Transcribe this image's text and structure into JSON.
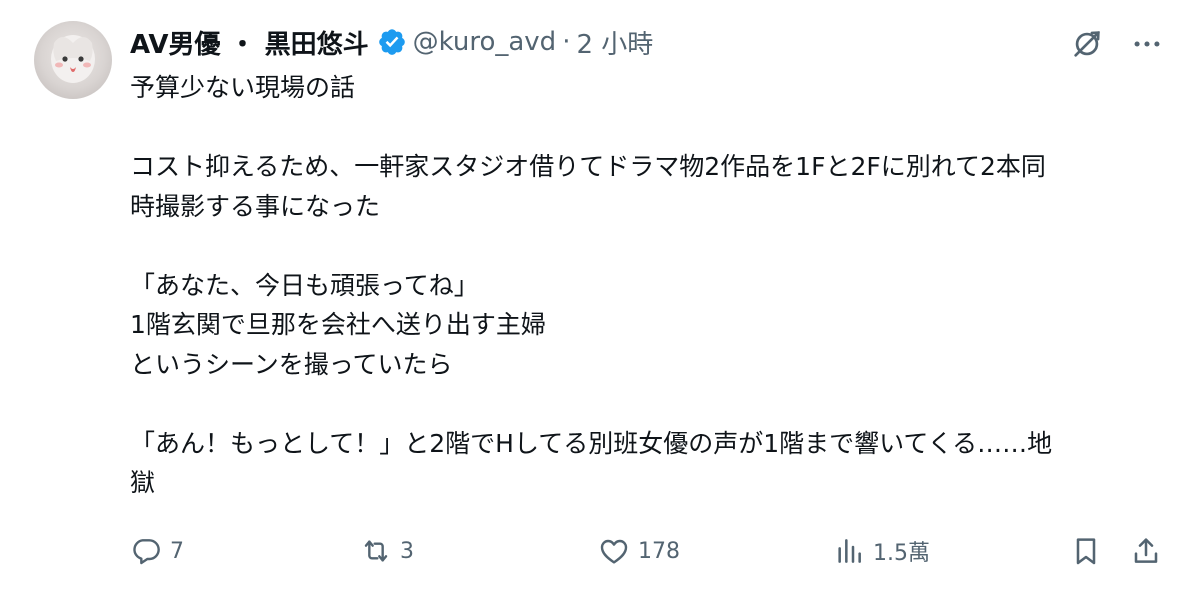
{
  "post": {
    "author": {
      "display_name": "AV男優 ・ 黒田悠斗",
      "handle": "@kuro_avd",
      "separator": "·",
      "time": "2 小時"
    },
    "icons": {
      "verified": "verified-badge-icon",
      "grok": "grok-icon",
      "more": "more-icon"
    },
    "body_lines": [
      "予算少ない現場の話",
      "",
      "コスト抑えるため、一軒家スタジオ借りてドラマ物2作品を1Fと2Fに別れて2本同",
      "時撮影する事になった",
      "",
      "「あなた、今日も頑張ってね」",
      "1階玄関で旦那を会社へ送り出す主婦",
      "というシーンを撮っていたら",
      "",
      "「あん！もっとして！」と2階でHしてる別班女優の声が1階まで響いてくる……地",
      "獄"
    ],
    "stats": {
      "replies": "7",
      "reposts": "3",
      "likes": "178",
      "views": "1.5萬"
    },
    "colors": {
      "text": "#0f1419",
      "secondary": "#536471",
      "verified": "#1d9bf0"
    }
  }
}
